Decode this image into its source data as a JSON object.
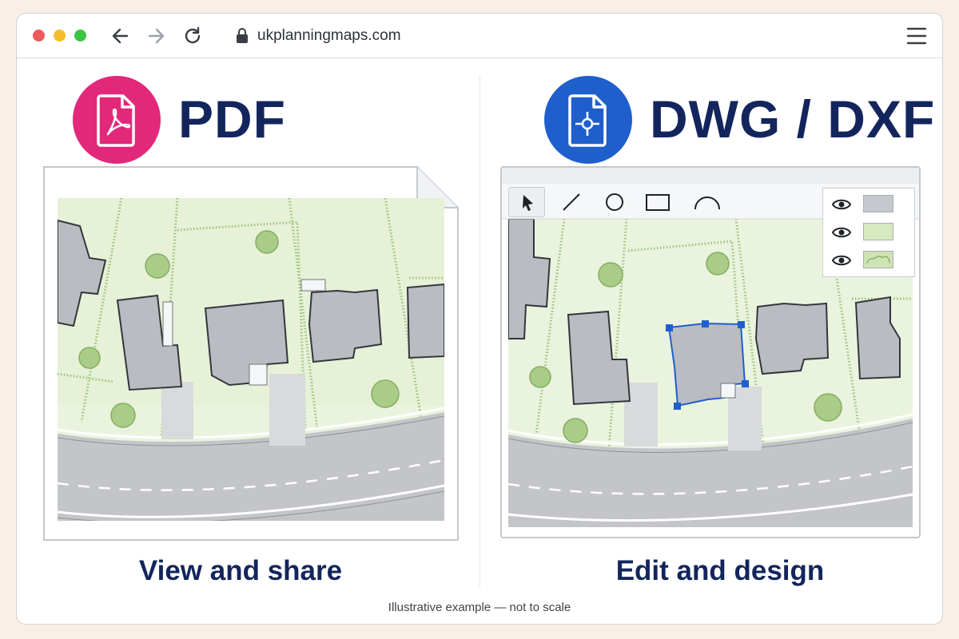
{
  "browser": {
    "url": "ukplanningmaps.com",
    "icons": [
      "back-arrow-icon",
      "forward-arrow-icon",
      "reload-icon",
      "lock-icon",
      "hamburger-menu-icon"
    ]
  },
  "left_panel": {
    "format_title": "PDF",
    "icon": "pdf-file-icon",
    "icon_color": "#e2287a",
    "caption": "View and share"
  },
  "right_panel": {
    "format_title": "DWG / DXF",
    "icon": "cad-file-icon",
    "icon_color": "#1f5fcc",
    "caption": "Edit and design",
    "toolbar": [
      "select-tool",
      "line-tool",
      "circle-tool",
      "rectangle-tool",
      "arc-tool"
    ],
    "layers": [
      {
        "icon": "eye-icon",
        "swatch": "#c5c8cd"
      },
      {
        "icon": "eye-icon",
        "swatch": "#d8e9c2"
      },
      {
        "icon": "eye-icon",
        "swatch": "#cfe3b5"
      }
    ]
  },
  "colors": {
    "navy": "#13255c",
    "grass": "#eaf3de",
    "road": "#c3c5c9",
    "building": "#b9bcc1",
    "tree": "#a9cc87",
    "selection": "#1f5fcc"
  },
  "footnote": "Illustrative example — not to scale"
}
